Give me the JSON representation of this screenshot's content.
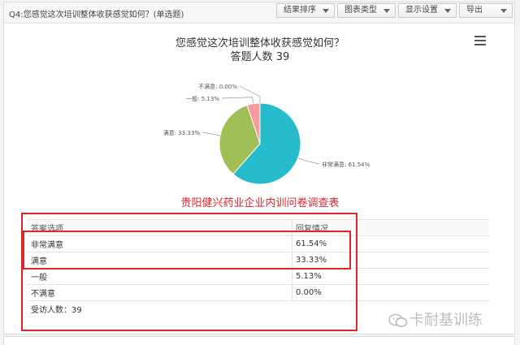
{
  "question": {
    "title": "Q4:您感觉这次培训整体收获感觉如何？(单选题)"
  },
  "toolbar": {
    "sort_label": "结果排序",
    "chart_type_label": "图表类型",
    "display_label": "显示设置",
    "export_label": "导出"
  },
  "chart": {
    "title_line1": "您感觉这次培训整体收获感觉如何？",
    "title_line2": "答题人数 39",
    "menu_icon": "hamburger-menu-icon"
  },
  "chart_data": {
    "type": "pie",
    "title": "您感觉这次培训整体收获感觉如何？",
    "subtitle": "答题人数 39",
    "slices": [
      {
        "label": "非常满意",
        "value": 61.54,
        "display": "非常满意: 61.54%",
        "color": "#27bccc"
      },
      {
        "label": "满意",
        "value": 33.33,
        "display": "满意: 33.33%",
        "color": "#a2bf55"
      },
      {
        "label": "一般",
        "value": 5.13,
        "display": "一般: 5.13%",
        "color": "#f39b9f"
      },
      {
        "label": "不满意",
        "value": 0.0,
        "display": "不满意: 0.00%",
        "color": "#8a8a8a"
      }
    ]
  },
  "company_caption": "贵阳健兴药业企业内训问卷调查表",
  "table": {
    "headers": [
      "答案选项",
      "回复情况"
    ],
    "rows": [
      [
        "非常满意",
        "61.54%"
      ],
      [
        "满意",
        "33.33%"
      ],
      [
        "一般",
        "5.13%"
      ],
      [
        "不满意",
        "0.00%"
      ]
    ],
    "footer": "受访人数：39"
  },
  "watermark": {
    "text": "卡耐基训练",
    "icon": "wechat-icon"
  },
  "colors": {
    "accent_red": "#e0242c",
    "caption_red": "#d9262d"
  }
}
